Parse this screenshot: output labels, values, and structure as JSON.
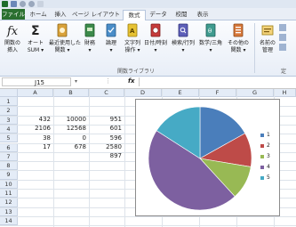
{
  "ribbon": {
    "tabs": [
      "ファイル",
      "ホーム",
      "挿入",
      "ページ レイアウト",
      "数式",
      "データ",
      "校閲",
      "表示"
    ],
    "buttons": [
      {
        "label1": "関数の",
        "label2": "挿入",
        "icon": "fx-icon"
      },
      {
        "label1": "オート",
        "label2": "SUM ▾",
        "icon": "sigma-icon"
      },
      {
        "label1": "最近使用した",
        "label2": "関数 ▾",
        "icon": "recent-book-icon"
      },
      {
        "label1": "財務",
        "label2": "▾",
        "icon": "financial-book-icon"
      },
      {
        "label1": "論理",
        "label2": "▾",
        "icon": "logical-book-icon"
      },
      {
        "label1": "文字列",
        "label2": "操作 ▾",
        "icon": "text-book-icon"
      },
      {
        "label1": "日付/時刻",
        "label2": "▾",
        "icon": "datetime-book-icon"
      },
      {
        "label1": "検索/行列",
        "label2": "▾",
        "icon": "lookup-book-icon"
      },
      {
        "label1": "数学/三角",
        "label2": "▾",
        "icon": "math-book-icon"
      },
      {
        "label1": "その他の",
        "label2": "関数 ▾",
        "icon": "more-book-icon"
      },
      {
        "label1": "名前の",
        "label2": "管理",
        "icon": "name-manager-icon"
      }
    ],
    "group_label": "関数ライブラリ",
    "group_label_right": "定"
  },
  "formula_bar": {
    "name_box": "J15",
    "fx": "fx",
    "value": ""
  },
  "sheet": {
    "columns": [
      "A",
      "B",
      "C",
      "D",
      "E",
      "F",
      "G",
      "H"
    ],
    "rows": [
      "1",
      "2",
      "3",
      "4",
      "5",
      "6",
      "7",
      "8",
      "9",
      "10",
      "11",
      "12",
      "13",
      "14"
    ],
    "cells": [
      {
        "row": 3,
        "col": "A",
        "value": "432"
      },
      {
        "row": 3,
        "col": "B",
        "value": "10000"
      },
      {
        "row": 3,
        "col": "C",
        "value": "951"
      },
      {
        "row": 4,
        "col": "A",
        "value": "2106"
      },
      {
        "row": 4,
        "col": "B",
        "value": "12568"
      },
      {
        "row": 4,
        "col": "C",
        "value": "601"
      },
      {
        "row": 5,
        "col": "A",
        "value": "38"
      },
      {
        "row": 5,
        "col": "B",
        "value": "0"
      },
      {
        "row": 5,
        "col": "C",
        "value": "596"
      },
      {
        "row": 6,
        "col": "A",
        "value": "17"
      },
      {
        "row": 6,
        "col": "B",
        "value": "678"
      },
      {
        "row": 6,
        "col": "C",
        "value": "2580"
      },
      {
        "row": 7,
        "col": "C",
        "value": "897"
      }
    ]
  },
  "chart_data": {
    "type": "pie",
    "categories": [
      "1",
      "2",
      "3",
      "4",
      "5"
    ],
    "values": [
      951,
      601,
      596,
      2580,
      897
    ],
    "colors": [
      "#4a7ebb",
      "#be4b48",
      "#98b954",
      "#7d60a0",
      "#46aac5"
    ],
    "legend_position": "right"
  }
}
